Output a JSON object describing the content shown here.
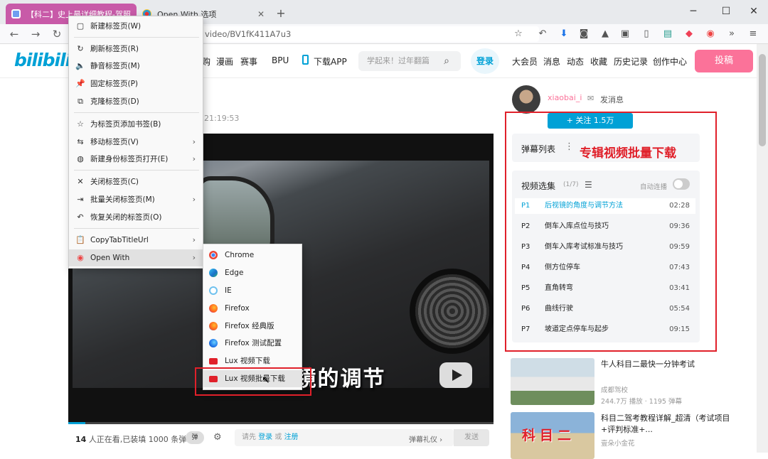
{
  "browser": {
    "tabs": [
      {
        "label": "【科二】史上最详细教程-驾照..."
      },
      {
        "label": "Open With 选项"
      }
    ],
    "url": "video/BV1fK411A7u3"
  },
  "bili": {
    "logo": "bilibili",
    "nav": [
      "购",
      "漫画",
      "赛事",
      "BPU",
      "下载APP"
    ],
    "search_placeholder": "学起来！过年翻篇",
    "login": "登录",
    "right_nav": [
      "大会员",
      "消息",
      "动态",
      "收藏",
      "历史记录",
      "创作中心"
    ],
    "upload": "投稿"
  },
  "video": {
    "time": "21:19:53",
    "subtitle": "关于 视镜的调节",
    "online_count": "14",
    "online_text": "人正在看,已装填 1000 条弹幕",
    "danmaku_toggle": "弹",
    "input_prefix": "请先",
    "input_login": "登录",
    "input_or": "或",
    "input_register": "注册",
    "etiquette": "弹幕礼仪 ›",
    "send": "发送",
    "progress": 0.04
  },
  "uploader": {
    "name": "xiaobai_i",
    "message": "发消息",
    "follow": "+  关注 1.5万"
  },
  "panel": {
    "danmaku_list": "弹幕列表",
    "annotation": "专辑视频批量下载",
    "playlist_title": "视频选集",
    "playlist_count": "(1/7)",
    "autoplay": "自动连播",
    "items": [
      {
        "p": "P1",
        "title": "后视镜的角度与调节方法",
        "duration": "02:28"
      },
      {
        "p": "P2",
        "title": "倒车入库点位与技巧",
        "duration": "09:36"
      },
      {
        "p": "P3",
        "title": "倒车入库考试标准与技巧",
        "duration": "09:59"
      },
      {
        "p": "P4",
        "title": "侧方位停车",
        "duration": "07:43"
      },
      {
        "p": "P5",
        "title": "直角转弯",
        "duration": "03:41"
      },
      {
        "p": "P6",
        "title": "曲线行驶",
        "duration": "05:54"
      },
      {
        "p": "P7",
        "title": "坡道定点停车与起步",
        "duration": "09:15"
      }
    ]
  },
  "recommended": [
    {
      "title": "牛人科目二最快一分钟考试",
      "author": "成都驾校",
      "stats": "244.7万 播放 · 1195 弹幕"
    },
    {
      "title": "科目二驾考教程详解_超清（考试项目+评判标准+...",
      "author": "壹朵小金花",
      "overlay": "科目二"
    }
  ],
  "context_menu": {
    "items": [
      {
        "label": "新建标签页(W)",
        "icon": "new-tab-icon",
        "glyph": "▢"
      },
      {
        "label": "刷新标签页(R)",
        "icon": "reload-icon",
        "glyph": "↻"
      },
      {
        "label": "静音标签页(M)",
        "icon": "speaker-icon",
        "glyph": "🔈"
      },
      {
        "label": "固定标签页(P)",
        "icon": "pin-icon",
        "glyph": "📌"
      },
      {
        "label": "克隆标签页(D)",
        "icon": "duplicate-icon",
        "glyph": "⧉"
      },
      {
        "label": "为标签页添加书签(B)",
        "icon": "star-icon",
        "glyph": "☆"
      },
      {
        "label": "移动标签页(V)",
        "icon": "move-icon",
        "glyph": "⇆"
      },
      {
        "label": "新建身份标签页打开(E)",
        "icon": "container-icon",
        "glyph": "◍"
      },
      {
        "label": "关闭标签页(C)",
        "icon": "close-icon",
        "glyph": "✕"
      },
      {
        "label": "批量关闭标签页(M)",
        "icon": "close-multiple-icon",
        "glyph": "⇥"
      },
      {
        "label": "恢复关闭的标签页(O)",
        "icon": "undo-icon",
        "glyph": "↶"
      },
      {
        "label": "CopyTabTitleUrl",
        "icon": "clipboard-icon",
        "glyph": "📋"
      },
      {
        "label": "Open With",
        "icon": "open-with-icon",
        "glyph": "◉"
      }
    ]
  },
  "open_with": {
    "items": [
      {
        "label": "Chrome",
        "icon": "chrome-icon"
      },
      {
        "label": "Edge",
        "icon": "edge-icon"
      },
      {
        "label": "IE",
        "icon": "ie-icon"
      },
      {
        "label": "Firefox",
        "icon": "firefox-icon"
      },
      {
        "label": "Firefox 经典版",
        "icon": "firefox-classic-icon"
      },
      {
        "label": "Firefox 测试配置",
        "icon": "firefox-test-icon"
      },
      {
        "label": "Lux 视频下载",
        "icon": "lux-video-icon"
      },
      {
        "label": "Lux 视频批量下载",
        "icon": "lux-batch-icon"
      }
    ]
  },
  "colors": {
    "bili_blue": "#00a1d6",
    "bili_pink": "#fb7299",
    "annotation_red": "#e0202a"
  }
}
